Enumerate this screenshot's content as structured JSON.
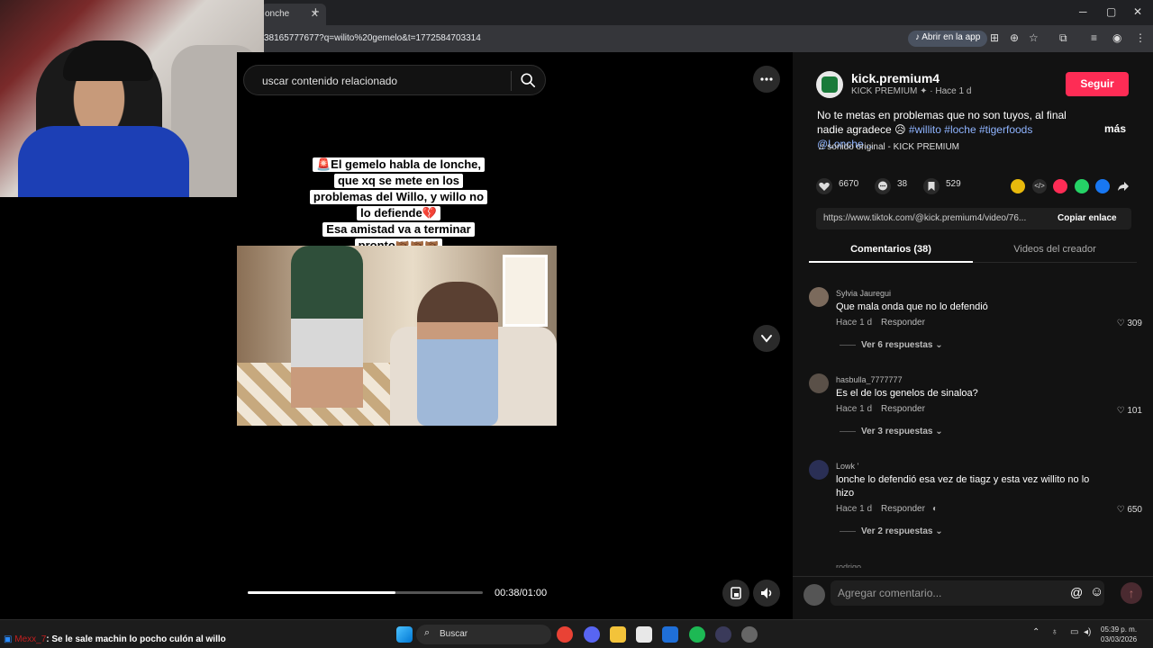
{
  "browser": {
    "tab_title": "onche",
    "url": "38165777677?q=wilito%20gemelo&t=1772584703314",
    "open_app_label": "Abrir en la app",
    "new_tab": "+",
    "tab_close": "✕"
  },
  "search": {
    "placeholder": "uscar contenido relacionado"
  },
  "video": {
    "caption_lines": [
      "🚨El gemelo habla de lonche,",
      "que xq se mete en los",
      "problemas del Willo, y willo no",
      "lo defiende💔",
      "Esa amistad va a terminar",
      "pronto🤝🏾🤝🏾🤝🏾"
    ],
    "time": "00:38/01:00",
    "progress": 0.63
  },
  "author": {
    "username": "kick.premium4",
    "display": "KICK PREMIUM",
    "posted": "Hace 1 d",
    "follow_label": "Seguir",
    "description": "No te metas en problemas que no son tuyos, al final nadie agradece 😥",
    "tags": "#willito #loche #tigerfoods @Lonche...",
    "more": "más",
    "sound": "sonido original - KICK PREMIUM"
  },
  "stats": {
    "likes": "6670",
    "comments": "38",
    "saves": "529"
  },
  "link": {
    "url": "https://www.tiktok.com/@kick.premium4/video/76...",
    "copy_label": "Copiar enlace"
  },
  "tabs": {
    "comments": "Comentarios (38)",
    "creator_videos": "Videos del creador"
  },
  "comments": [
    {
      "user": "Sylvia Jauregui",
      "text": "Que mala onda que no lo defendió",
      "time": "Hace 1 d",
      "reply": "Responder",
      "likes": "309",
      "replies": "Ver 6 respuestas"
    },
    {
      "user": "hasbulla_7777777",
      "text": "Es el de los genelos de sinaloa?",
      "time": "Hace 1 d",
      "reply": "Responder",
      "likes": "101",
      "replies": "Ver 3 respuestas"
    },
    {
      "user": "Lowk '",
      "text": "lonche lo defendió esa vez de tiagz y esta vez willito no lo hizo",
      "time": "Hace 1 d",
      "reply": "Responder",
      "likes": "650",
      "replies": "Ver 2 respuestas"
    }
  ],
  "next_comment_user": "rodrigo",
  "comment_input": {
    "placeholder": "Agregar comentario...",
    "at": "@"
  },
  "taskbar": {
    "chat_user": "Mexx_7",
    "chat_text": ": Se le sale machin lo pocho culón al willo",
    "search_label": "Buscar",
    "time": "05:39 p. m.",
    "date": "03/03/2026"
  },
  "colors": {
    "follow": "#fe2c55",
    "tag": "#8fb4ff",
    "panel": "#121212"
  }
}
